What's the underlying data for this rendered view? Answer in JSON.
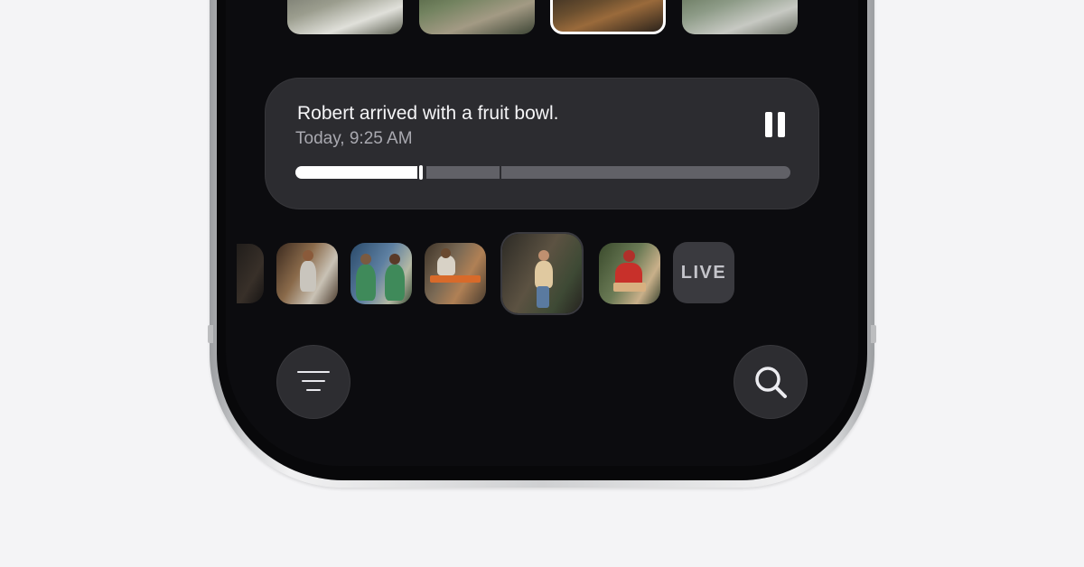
{
  "event_card": {
    "title": "Robert arrived with a fruit bowl.",
    "time": "Today, 9:25 AM",
    "pause_icon": "pause-icon",
    "progress": 0.25
  },
  "top_thumbnails": [
    {
      "selected": false
    },
    {
      "selected": false
    },
    {
      "selected": true
    },
    {
      "selected": false
    }
  ],
  "timeline": {
    "clips": 6,
    "live_label": "LIVE"
  },
  "bottom_bar": {
    "filter_icon": "filter-icon",
    "search_icon": "search-icon"
  },
  "colors": {
    "background": "#f4f4f6",
    "screen": "#0c0c0f",
    "card": "#2c2c30",
    "track": "#616167",
    "accent": "#ffffff"
  }
}
